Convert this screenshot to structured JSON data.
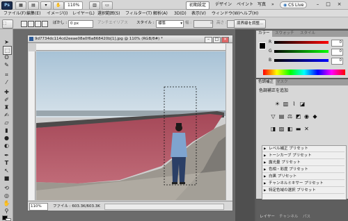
{
  "appbar": {
    "logo": "Ps",
    "zoom": "110%",
    "workspaces": [
      "初期設定",
      "デザイン",
      "ペイント",
      "写真"
    ],
    "more": "»",
    "cs_live": "CS Live",
    "controls": [
      "–",
      "□",
      "×"
    ]
  },
  "menubar": {
    "items": [
      "ファイル(F)",
      "編集(E)",
      "イメージ(I)",
      "レイヤー(L)",
      "選択範囲(S)",
      "フィルター(T)",
      "解析(A)",
      "3D(D)",
      "表示(V)",
      "ウィンドウ(W)",
      "ヘルプ(H)"
    ]
  },
  "options": {
    "feather_label": "ぼかし :",
    "feather_value": "0 px",
    "antialias_label": "アンチエイリアス",
    "style_label": "スタイル :",
    "style_value": "標準",
    "width_label": "幅 :",
    "height_label": "高さ :",
    "refine_button": "境界線を調整..."
  },
  "document": {
    "title": "9d7734dc114cd2eeae08a0f6a868420b[1].jpg @ 110% (RGB/8#) *",
    "zoom_field": "110%",
    "file_info": "ファイル : 603.3K/603.3K"
  },
  "color_panel": {
    "tabs": [
      "カラー",
      "スウォッチ",
      "スタイル"
    ],
    "channels": [
      {
        "name": "R",
        "value": "0"
      },
      {
        "name": "G",
        "value": "0"
      },
      {
        "name": "B",
        "value": "0"
      }
    ]
  },
  "adjust_panel": {
    "tabs": [
      "色調補正",
      "マスク"
    ],
    "heading": "色調補正を追加",
    "presets": [
      "レベル補正 プリセット",
      "トーンカーブ プリセット",
      "露光量 プリセット",
      "色相・彩度 プリセット",
      "白黒 プリセット",
      "チャンネルミキサー プリセット",
      "特定色域の選択 プリセット"
    ]
  },
  "bottom_tabs": [
    "レイヤー",
    "チャンネル",
    "パス"
  ],
  "colors": {
    "app_bg": "#6b6b6b",
    "panel_bg": "#d7d7d7",
    "sky": "#a9c3d8",
    "red_field": "#b55462"
  }
}
